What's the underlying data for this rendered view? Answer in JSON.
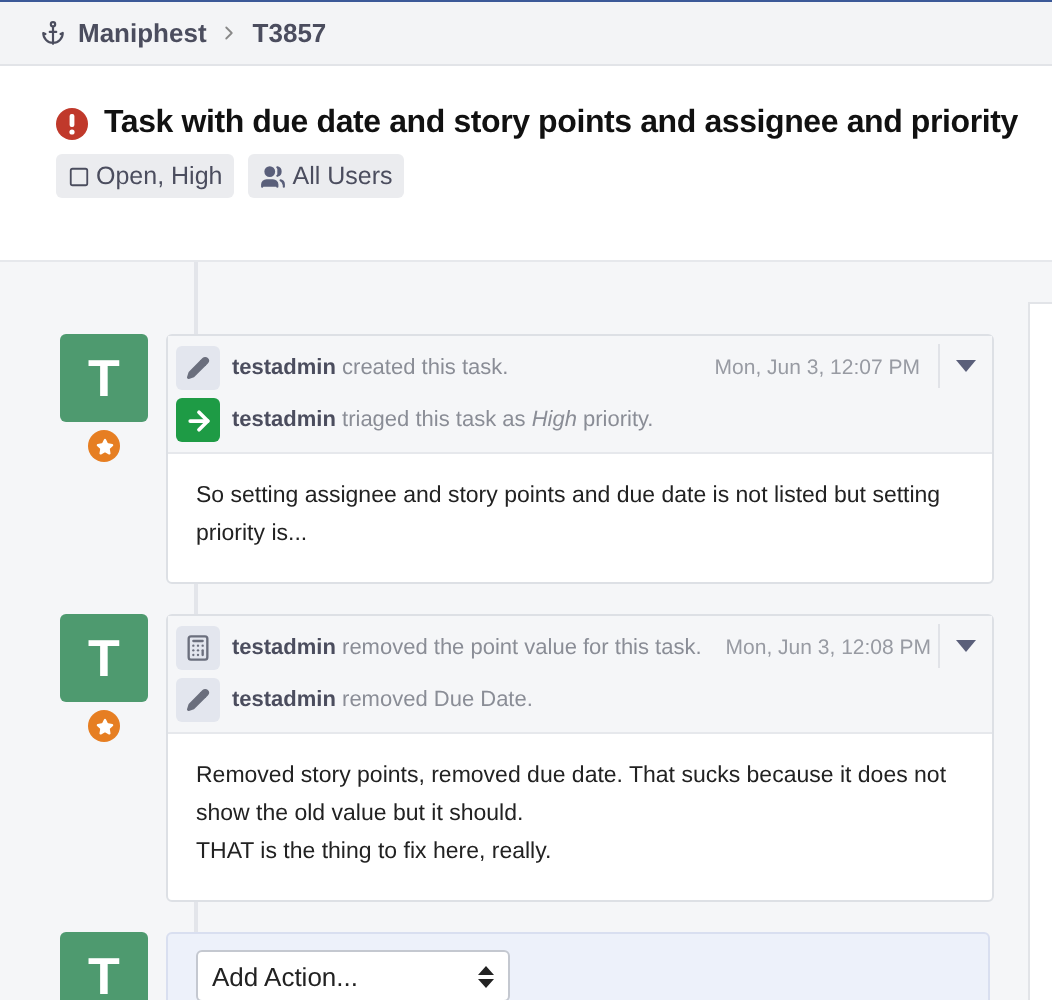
{
  "breadcrumbs": [
    {
      "label": "Maniphest",
      "kind": "app"
    },
    {
      "label": "T3857",
      "kind": "item"
    }
  ],
  "header": {
    "title": "Task with due date and story points and assignee and priority",
    "tags": [
      {
        "kind": "status",
        "label": "Open, High"
      },
      {
        "kind": "policy",
        "label": "All Users"
      }
    ]
  },
  "timeline": [
    {
      "avatar": "T",
      "badge": true,
      "timestamp": "Mon, Jun 3, 12:07 PM",
      "events": [
        {
          "kind": "edit",
          "actor": "testadmin",
          "action": "created this task."
        },
        {
          "kind": "triage",
          "actor": "testadmin",
          "action": "triaged this task as *High* priority."
        }
      ],
      "body": [
        "So setting assignee and story points and due date is not listed but setting priority is..."
      ]
    },
    {
      "avatar": "T",
      "badge": true,
      "timestamp": "Mon, Jun 3, 12:08 PM",
      "events": [
        {
          "kind": "points",
          "actor": "testadmin",
          "action": "removed the point value for this task."
        },
        {
          "kind": "edit",
          "actor": "testadmin",
          "action": "removed Due Date."
        }
      ],
      "body": [
        "Removed story points, removed due date. That sucks because it does not show the old value but it should.",
        "THAT is the thing to fix here, really."
      ]
    }
  ],
  "comment_form": {
    "avatar": "T",
    "action_select": "Add Action..."
  }
}
